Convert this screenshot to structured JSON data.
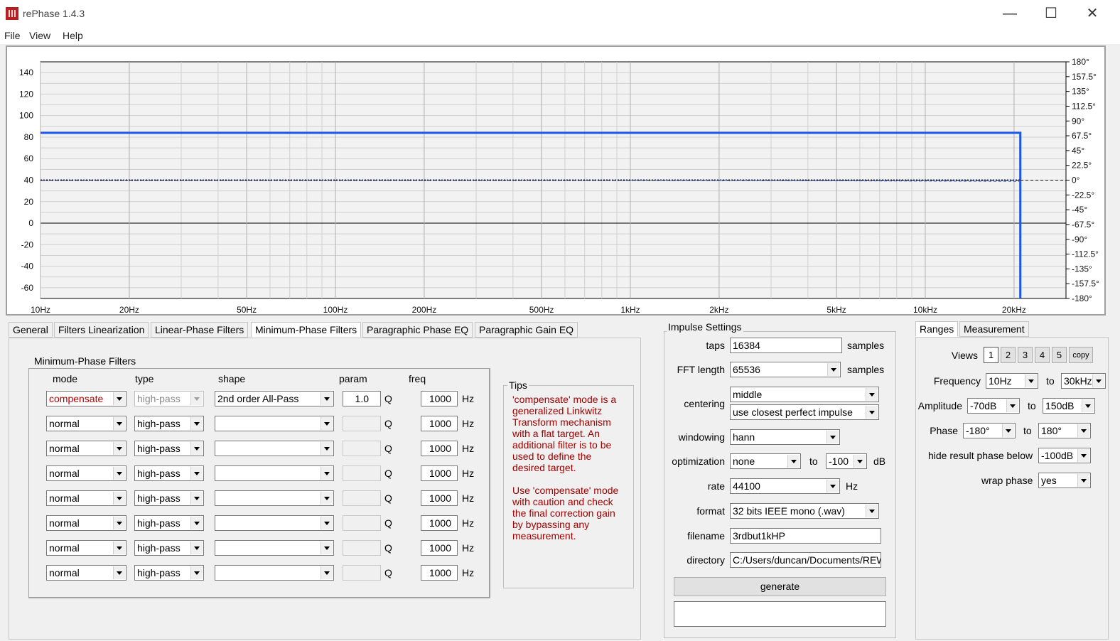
{
  "window": {
    "title": "rePhase 1.4.3"
  },
  "menu": [
    "File",
    "View",
    "Help"
  ],
  "chart_data": {
    "type": "line",
    "x_ticks": [
      "10Hz",
      "20Hz",
      "50Hz",
      "100Hz",
      "200Hz",
      "500Hz",
      "1kHz",
      "2kHz",
      "5kHz",
      "10kHz",
      "20kHz"
    ],
    "x_tick_values": [
      10,
      20,
      50,
      100,
      200,
      500,
      1000,
      2000,
      5000,
      10000,
      20000
    ],
    "xlim": [
      10,
      30000
    ],
    "x_scale": "log",
    "y_ticks": [
      "140",
      "120",
      "100",
      "80",
      "60",
      "40",
      "20",
      "0",
      "-20",
      "-40",
      "-60"
    ],
    "ylim": [
      -70,
      150
    ],
    "y2_ticks": [
      "180°",
      "157.5°",
      "135°",
      "112.5°",
      "90°",
      "67.5°",
      "45°",
      "22.5°",
      "0°",
      "-22.5°",
      "-45°",
      "-67.5°",
      "-90°",
      "-112.5°",
      "-135°",
      "-157.5°",
      "-180°"
    ],
    "y2lim": [
      -180,
      180
    ],
    "grid": true,
    "series": [
      {
        "axis": "amplitude",
        "style": "solid",
        "color": "#1a56e8",
        "x": [
          10,
          21000,
          21000
        ],
        "y": [
          84,
          84,
          -70
        ]
      },
      {
        "axis": "phase",
        "style": "dotted",
        "color": "#1a2a6e",
        "x": [
          10,
          21000
        ],
        "y": [
          0,
          0
        ]
      },
      {
        "axis": "phase",
        "style": "dashed",
        "color": "#4a6ec8",
        "x": [
          1000,
          21000
        ],
        "y": [
          0,
          -2
        ]
      },
      {
        "axis": "phase",
        "style": "dashed",
        "color": "#000000",
        "x": [
          10,
          30000
        ],
        "y": [
          0,
          0
        ]
      }
    ]
  },
  "tabs": [
    "General",
    "Filters Linearization",
    "Linear-Phase Filters",
    "Minimum-Phase Filters",
    "Paragraphic Phase EQ",
    "Paragraphic Gain EQ"
  ],
  "mp": {
    "group_title": "Minimum-Phase Filters",
    "headers": {
      "mode": "mode",
      "type": "type",
      "shape": "shape",
      "param": "param",
      "freq": "freq"
    },
    "q_unit": "Q",
    "hz_unit": "Hz",
    "rows": [
      {
        "mode": "compensate",
        "type": "high-pass",
        "shape": "2nd order All-Pass",
        "param": "1.0",
        "freq": "1000"
      },
      {
        "mode": "normal",
        "type": "high-pass",
        "shape": "",
        "param": "",
        "freq": "1000"
      },
      {
        "mode": "normal",
        "type": "high-pass",
        "shape": "",
        "param": "",
        "freq": "1000"
      },
      {
        "mode": "normal",
        "type": "high-pass",
        "shape": "",
        "param": "",
        "freq": "1000"
      },
      {
        "mode": "normal",
        "type": "high-pass",
        "shape": "",
        "param": "",
        "freq": "1000"
      },
      {
        "mode": "normal",
        "type": "high-pass",
        "shape": "",
        "param": "",
        "freq": "1000"
      },
      {
        "mode": "normal",
        "type": "high-pass",
        "shape": "",
        "param": "",
        "freq": "1000"
      },
      {
        "mode": "normal",
        "type": "high-pass",
        "shape": "",
        "param": "",
        "freq": "1000"
      }
    ]
  },
  "tips": {
    "title": "Tips",
    "text": "'compensate' mode is a\ngeneralized Linkwitz\nTransform mechanism\nwith a flat target. An\nadditional filter is to be\nused to define the\ndesired target.\n\nUse 'compensate' mode\nwith caution and check\nthe final correction gain\nby bypassing any\nmeasurement."
  },
  "impulse": {
    "title": "Impulse Settings",
    "taps_label": "taps",
    "taps": "16384",
    "samples": "samples",
    "fft_label": "FFT length",
    "fft": "65536",
    "centering_label": "centering",
    "centering1": "middle",
    "centering2": "use closest perfect impulse",
    "windowing_label": "windowing",
    "windowing": "hann",
    "optimization_label": "optimization",
    "optimization": "none",
    "to": "to",
    "opt_to": "-100",
    "db": "dB",
    "rate_label": "rate",
    "rate": "44100",
    "hz": "Hz",
    "format_label": "format",
    "format": "32 bits IEEE mono (.wav)",
    "filename_label": "filename",
    "filename": "3rdbut1kHP",
    "directory_label": "directory",
    "directory": "C:/Users/duncan/Documents/REW",
    "generate": "generate"
  },
  "ranges": {
    "tabs": [
      "Ranges",
      "Measurement"
    ],
    "views_label": "Views",
    "views": [
      "1",
      "2",
      "3",
      "4",
      "5",
      "copy"
    ],
    "frequency_label": "Frequency",
    "freq_from": "10Hz",
    "to": "to",
    "freq_to": "30kHz",
    "amplitude_label": "Amplitude",
    "amp_from": "-70dB",
    "amp_to": "150dB",
    "phase_label": "Phase",
    "phase_from": "-180°",
    "phase_to": "180°",
    "hide_label": "hide result phase below",
    "hide": "-100dB",
    "wrap_label": "wrap phase",
    "wrap": "yes"
  }
}
